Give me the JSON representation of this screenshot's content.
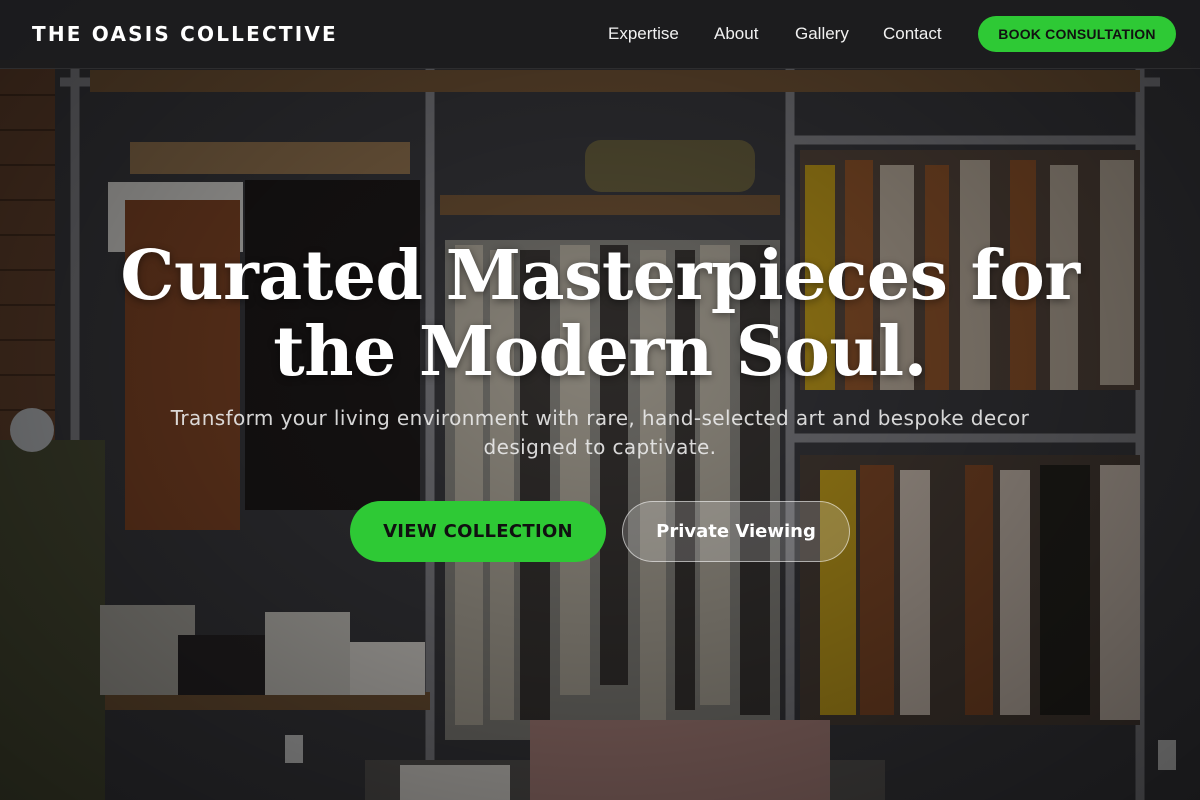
{
  "brand": {
    "name": "THE OASIS COLLECTIVE"
  },
  "nav": {
    "links": [
      "Expertise",
      "About",
      "Gallery",
      "Contact"
    ],
    "cta_label": "BOOK CONSULTATION"
  },
  "hero": {
    "headline_line1": "Curated Masterpieces for",
    "headline_line2": "the Modern Soul.",
    "subtitle_line1": "Transform your living environment with rare, hand-selected art and bespoke decor",
    "subtitle_line2": "designed to captivate.",
    "primary_button": "VIEW COLLECTION",
    "secondary_button": "Private Viewing",
    "background_image": "boutique-clothing-racks-photo"
  },
  "colors": {
    "accent": "#2ec935",
    "navbar_bg": "#1c1c1e",
    "text": "#ffffff"
  }
}
